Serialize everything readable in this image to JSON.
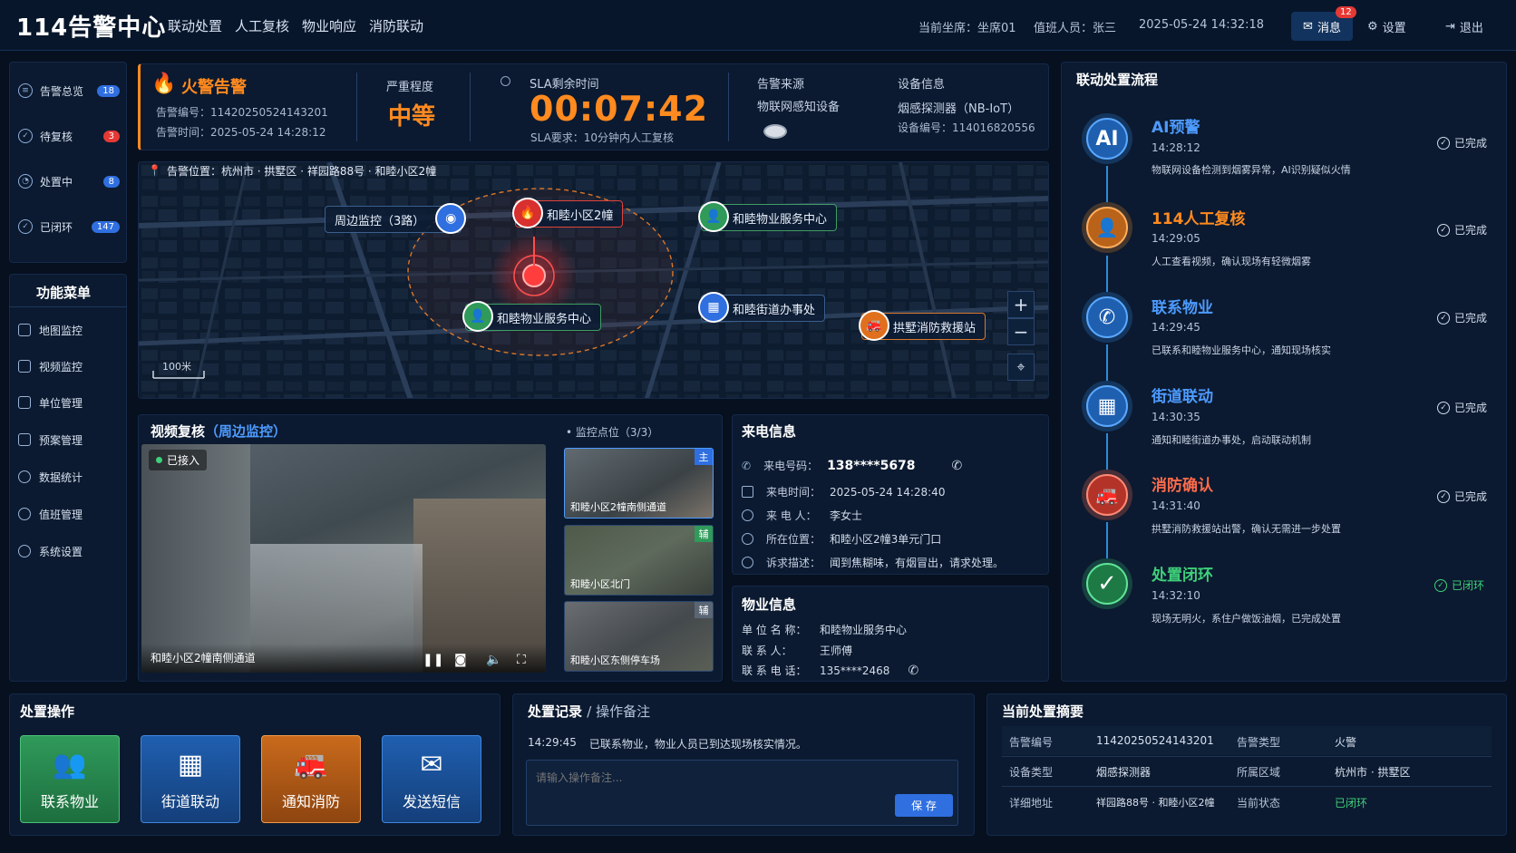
{
  "app": {
    "title": "114告警中心"
  },
  "topnav": [
    "联动处置",
    "人工复核",
    "物业响应",
    "消防联动"
  ],
  "topinfo": {
    "seat": "当前坐席：坐席01",
    "duty": "值班人员：张三",
    "datetime": "2025-05-24  14:32:18"
  },
  "topright": {
    "messages": "消息",
    "msg_count": "12",
    "settings": "设置",
    "logout": "退出"
  },
  "stats": [
    {
      "label": "告警总览",
      "count": "18",
      "color": "#2f6fe0"
    },
    {
      "label": "待复核",
      "count": "3",
      "color": "#e53935"
    },
    {
      "label": "处置中",
      "count": "8",
      "color": "#2f6fe0"
    },
    {
      "label": "已闭环",
      "count": "147",
      "color": "#2f6fe0"
    }
  ],
  "menu": {
    "title": "功能菜单",
    "items": [
      "地图监控",
      "视频监控",
      "单位管理",
      "预案管理",
      "数据统计",
      "值班管理",
      "系统设置"
    ]
  },
  "alarm": {
    "title": "火警告警",
    "id": "告警编号：11420250524143201",
    "time": "告警时间：2025-05-24  14:28:12",
    "severity_label": "严重程度",
    "severity": "中等",
    "sla_label": "SLA剩余时间",
    "sla_time": "00:07:42",
    "sla_req": "SLA要求：10分钟内人工复核",
    "source_label": "告警来源",
    "source": "物联网感知设备",
    "device_label": "设备信息",
    "device": "烟感探测器（NB-IoT）",
    "device_id": "设备编号：114016820556"
  },
  "map": {
    "location": "告警位置：杭州市 · 拱墅区 · 祥园路88号 · 和睦小区2幢",
    "pins": {
      "camera": "周边监控（3路）",
      "fire": "和睦小区2幢",
      "property_a": "和睦物业服务中心",
      "property_b": "和睦物业服务中心",
      "street": "和睦街道办事处",
      "firestation": "拱墅消防救援站"
    },
    "scale": "100米",
    "zoom_in": "+",
    "zoom_out": "−"
  },
  "video": {
    "title": "视频复核",
    "subtitle": "（周边监控）",
    "points_label": "• 监控点位（3/3）",
    "status": "已接入",
    "main_caption": "和睦小区2幢南侧通道",
    "thumbs": [
      {
        "caption": "和睦小区2幢南侧通道",
        "tag": "主"
      },
      {
        "caption": "和睦小区北门",
        "tag": "辅"
      },
      {
        "caption": "和睦小区东侧停车场",
        "tag": "辅"
      }
    ]
  },
  "call": {
    "title": "来电信息",
    "rows": [
      {
        "k": "来电号码：",
        "v": "138****5678"
      },
      {
        "k": "来电时间：",
        "v": "2025-05-24  14:28:40"
      },
      {
        "k": "来 电 人：",
        "v": "李女士"
      },
      {
        "k": "所在位置：",
        "v": "和睦小区2幢3单元门口"
      },
      {
        "k": "诉求描述：",
        "v": "闻到焦糊味，有烟冒出，请求处理。"
      }
    ]
  },
  "property": {
    "title": "物业信息",
    "rows": [
      {
        "k": "单 位 名 称：",
        "v": "和睦物业服务中心"
      },
      {
        "k": "联   系   人：",
        "v": "王师傅"
      },
      {
        "k": "联 系 电 话：",
        "v": "135****2468"
      }
    ]
  },
  "flow": {
    "title": "联动处置流程",
    "steps": [
      {
        "icon": "AI",
        "title": "AI预警",
        "time": "14:28:12",
        "desc": "物联网设备检测到烟雾异常，AI识别疑似火情",
        "status": "已完成",
        "color": "#2f8ae8"
      },
      {
        "icon": "👤",
        "title": "114人工复核",
        "time": "14:29:05",
        "desc": "人工查看视频，确认现场有轻微烟雾",
        "status": "已完成",
        "color": "#f08a24"
      },
      {
        "icon": "✆",
        "title": "联系物业",
        "time": "14:29:45",
        "desc": "已联系和睦物业服务中心，通知现场核实",
        "status": "已完成",
        "color": "#2f8ae8"
      },
      {
        "icon": "▦",
        "title": "街道联动",
        "time": "14:30:35",
        "desc": "通知和睦街道办事处，启动联动机制",
        "status": "已完成",
        "color": "#2f8ae8"
      },
      {
        "icon": "🚒",
        "title": "消防确认",
        "time": "14:31:40",
        "desc": "拱墅消防救援站出警，确认无需进一步处置",
        "status": "已完成",
        "color": "#ff6b4a"
      },
      {
        "icon": "✓",
        "title": "处置闭环",
        "time": "14:32:10",
        "desc": "现场无明火，系住户做饭油烟，已完成处置",
        "status": "已闭环",
        "color": "#3fd07b"
      }
    ]
  },
  "actions": {
    "title": "处置操作",
    "buttons": [
      {
        "label": "联系物业",
        "icon": "👥"
      },
      {
        "label": "街道联动",
        "icon": "▦"
      },
      {
        "label": "通知消防",
        "icon": "🚒"
      },
      {
        "label": "发送短信",
        "icon": "✉"
      }
    ]
  },
  "records": {
    "title": "处置记录",
    "title2": "/ 操作备注",
    "entry_time": "14:29:45",
    "entry_text": "已联系物业，物业人员已到达现场核实情况。",
    "placeholder": "请输入操作备注...",
    "save": "保 存"
  },
  "summary": {
    "title": "当前处置摘要",
    "rows": [
      {
        "k1": "告警编号",
        "v1": "11420250524143201",
        "k2": "告警类型",
        "v2": "火警"
      },
      {
        "k1": "设备类型",
        "v1": "烟感探测器",
        "k2": "所属区域",
        "v2": "杭州市 · 拱墅区"
      },
      {
        "k1": "详细地址",
        "v1": "祥园路88号 · 和睦小区2幢",
        "k2": "当前状态",
        "v2": "已闭环"
      }
    ]
  }
}
